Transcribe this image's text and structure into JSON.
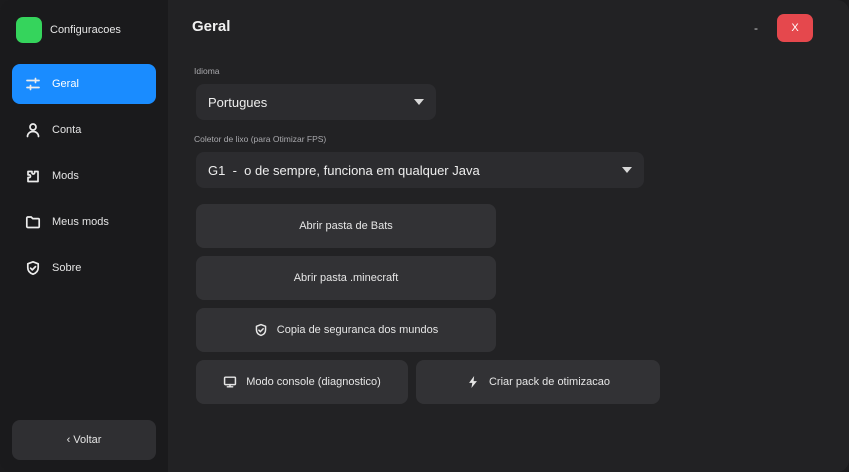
{
  "app": {
    "title": "Configuracoes",
    "logo_color": "#35d45c"
  },
  "sidebar": {
    "items": [
      {
        "label": "Geral",
        "icon": "sliders-icon",
        "active": true
      },
      {
        "label": "Conta",
        "icon": "user-icon",
        "active": false
      },
      {
        "label": "Mods",
        "icon": "puzzle-icon",
        "active": false
      },
      {
        "label": "Meus mods",
        "icon": "folder-icon",
        "active": false
      },
      {
        "label": "Sobre",
        "icon": "shield-check-icon",
        "active": false
      }
    ],
    "back_label": "‹ Voltar",
    "active_color": "#1a8cff"
  },
  "header": {
    "title": "Geral",
    "minimize_label": "-",
    "close_label": "X",
    "close_color": "#e5484d"
  },
  "settings": {
    "language": {
      "label": "Idioma",
      "value": "Portugues"
    },
    "gc": {
      "label": "Coletor de lixo (para Otimizar FPS)",
      "value": "G1  -  o de sempre, funciona em qualquer Java"
    }
  },
  "actions": {
    "open_bats": "Abrir pasta de Bats",
    "open_minecraft": "Abrir pasta .minecraft",
    "backup_worlds": "Copia de seguranca dos mundos",
    "console_mode": "Modo console (diagnostico)",
    "create_pack": "Criar pack de otimizacao"
  }
}
